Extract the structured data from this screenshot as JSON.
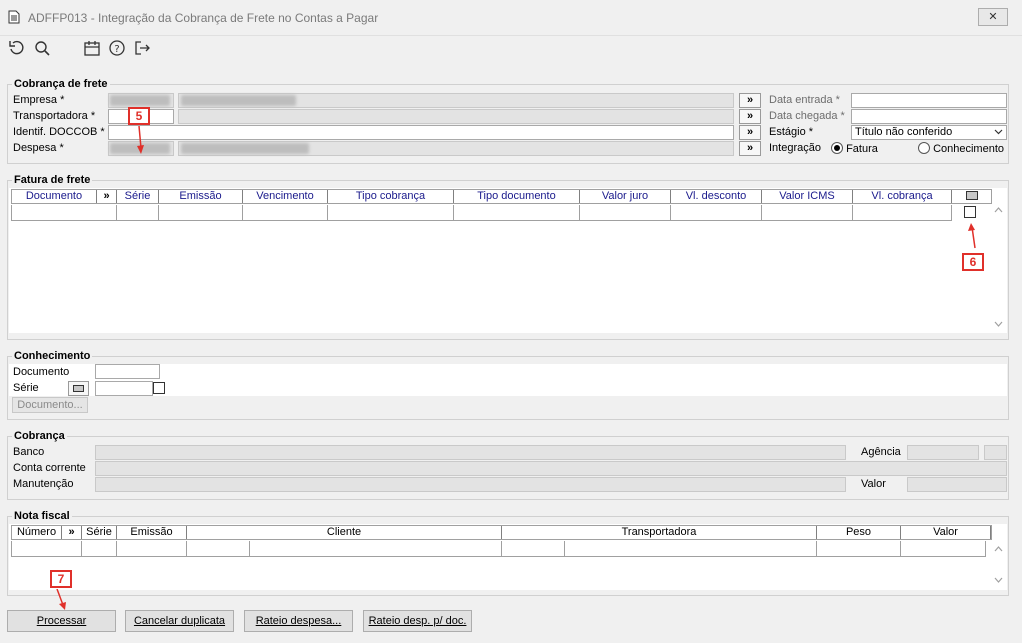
{
  "window": {
    "title": "ADFFP013 - Integração da Cobrança de Frete no Contas a Pagar",
    "close_glyph": "✕"
  },
  "toolbar": {
    "icons": [
      "undo-icon",
      "search-icon",
      "calendar-icon",
      "help-icon",
      "exit-icon"
    ]
  },
  "cobranca_frete": {
    "title": "Cobrança de frete",
    "empresa_label": "Empresa *",
    "transportadora_label": "Transportadora *",
    "identif_label": "Identif. DOCCOB *",
    "despesa_label": "Despesa *",
    "lookup_label": "»",
    "data_entrada_label": "Data entrada *",
    "data_chegada_label": "Data chegada *",
    "estagio_label": "Estágio *",
    "estagio_value": "Título não conferido",
    "integracao_label": "Integração",
    "opt_fatura": "Fatura",
    "opt_conhecimento": "Conhecimento"
  },
  "fatura_frete": {
    "title": "Fatura de frete",
    "columns": [
      "Documento",
      "»",
      "Série",
      "Emissão",
      "Vencimento",
      "Tipo cobrança",
      "Tipo documento",
      "Valor juro",
      "Vl. desconto",
      "Valor ICMS",
      "Vl. cobrança"
    ]
  },
  "conhecimento": {
    "title": "Conhecimento",
    "documento_label": "Documento",
    "serie_label": "Série",
    "documento_button": "Documento..."
  },
  "cobranca": {
    "title": "Cobrança",
    "banco_label": "Banco",
    "agencia_label": "Agência",
    "conta_label": "Conta corrente",
    "manutencao_label": "Manutenção",
    "valor_label": "Valor"
  },
  "nota_fiscal": {
    "title": "Nota fiscal",
    "columns": [
      "Número",
      "»",
      "Série",
      "Emissão",
      "Cliente",
      "Transportadora",
      "Peso",
      "Valor"
    ]
  },
  "buttons": {
    "processar": "Processar",
    "cancelar": "Cancelar duplicata",
    "rateio": "Rateio despesa...",
    "rateio_doc": "Rateio desp. p/ doc."
  },
  "annotations": {
    "a5": "5",
    "a6": "6",
    "a7": "7"
  },
  "colors": {
    "annotation": "#e0302a",
    "header_text": "#1a1a8c",
    "background": "#f0f0f0"
  }
}
